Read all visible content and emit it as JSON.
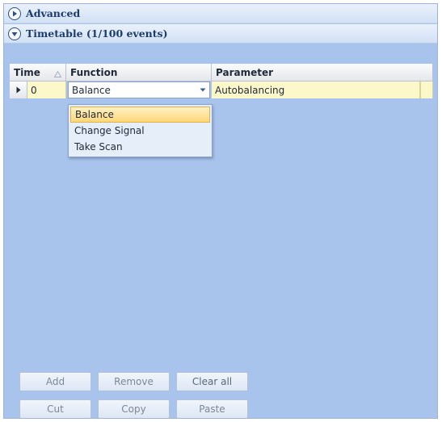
{
  "sections": {
    "advanced": {
      "title": "Advanced",
      "expanded": false
    },
    "timetable": {
      "title": "Timetable (1/100 events)",
      "expanded": true
    }
  },
  "grid": {
    "columns": [
      "Time",
      "Function",
      "Parameter"
    ],
    "rows": [
      {
        "time": "0",
        "function": "Balance",
        "parameter": "Autobalancing"
      }
    ]
  },
  "function_dropdown": {
    "options": [
      "Balance",
      "Change Signal",
      "Take Scan"
    ],
    "selected": "Balance"
  },
  "buttons": {
    "add": "Add",
    "remove": "Remove",
    "clear_all": "Clear all",
    "cut": "Cut",
    "copy": "Copy",
    "paste": "Paste"
  },
  "colors": {
    "panel_background": "#a9c4ec",
    "selected_row": "#fdf8c9",
    "header_text": "#1d3c6e",
    "dropdown_highlight": "#ffd77a"
  },
  "icons": {
    "advanced_toggle": "expand-circle-right-icon",
    "timetable_toggle": "collapse-circle-down-icon",
    "row_indicator": "triangle-right-icon",
    "combo_arrow": "chevron-down-icon",
    "sort": "sort-ascending-icon"
  }
}
